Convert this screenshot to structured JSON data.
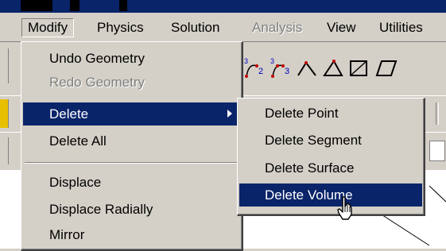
{
  "menubar": {
    "items": [
      {
        "label": "Modify",
        "state": "open"
      },
      {
        "label": "Physics",
        "state": "normal"
      },
      {
        "label": "Solution",
        "state": "normal"
      },
      {
        "label": "Analysis",
        "state": "disabled"
      },
      {
        "label": "View",
        "state": "normal"
      },
      {
        "label": "Utilities",
        "state": "normal"
      }
    ]
  },
  "modify_menu": {
    "items": [
      {
        "label": "Undo Geometry",
        "state": "normal"
      },
      {
        "label": "Redo Geometry",
        "state": "disabled"
      },
      {
        "label": "Delete",
        "state": "highlighted",
        "submenu": true
      },
      {
        "label": "Delete All",
        "state": "normal"
      },
      {
        "label": "Displace",
        "state": "normal"
      },
      {
        "label": "Displace Radially",
        "state": "normal"
      },
      {
        "label": "Mirror",
        "state": "normal"
      }
    ]
  },
  "delete_submenu": {
    "items": [
      {
        "label": "Delete Point",
        "state": "normal"
      },
      {
        "label": "Delete Segment",
        "state": "normal"
      },
      {
        "label": "Delete Surface",
        "state": "normal"
      },
      {
        "label": "Delete Volume",
        "state": "highlighted"
      }
    ]
  },
  "toolbar": {
    "icons": [
      "curve-2-points-icon",
      "curve-3-points-icon",
      "arc-icon",
      "polygon-icon",
      "rectangle-icon",
      "surface-icon"
    ]
  },
  "colors": {
    "menu_bg": "#d4d0c8",
    "highlight": "#0a246a",
    "highlight_text": "#ffffff",
    "disabled_text": "#808080"
  }
}
